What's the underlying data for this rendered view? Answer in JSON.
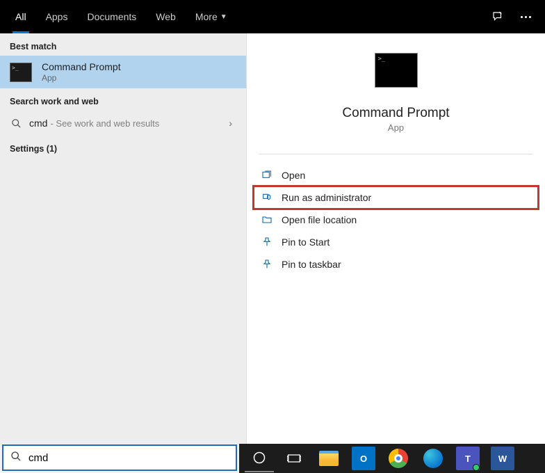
{
  "tabs": {
    "all": "All",
    "apps": "Apps",
    "documents": "Documents",
    "web": "Web",
    "more": "More"
  },
  "sections": {
    "best_match": "Best match",
    "search_ww": "Search work and web"
  },
  "best_match": {
    "title": "Command Prompt",
    "subtitle": "App"
  },
  "web_result": {
    "query": "cmd",
    "hint": "- See work and web results"
  },
  "settings_section": "Settings (1)",
  "hero": {
    "name": "Command Prompt",
    "type": "App"
  },
  "actions": {
    "open": "Open",
    "run_admin": "Run as administrator",
    "open_loc": "Open file location",
    "pin_start": "Pin to Start",
    "pin_taskbar": "Pin to taskbar"
  },
  "search_value": "cmd",
  "taskbar": {
    "cortana": "Cortana",
    "taskview": "Task View",
    "explorer": "File Explorer",
    "outlook": "Outlook",
    "chrome": "Chrome",
    "edge": "Edge",
    "teams": "Teams",
    "word": "Word"
  }
}
